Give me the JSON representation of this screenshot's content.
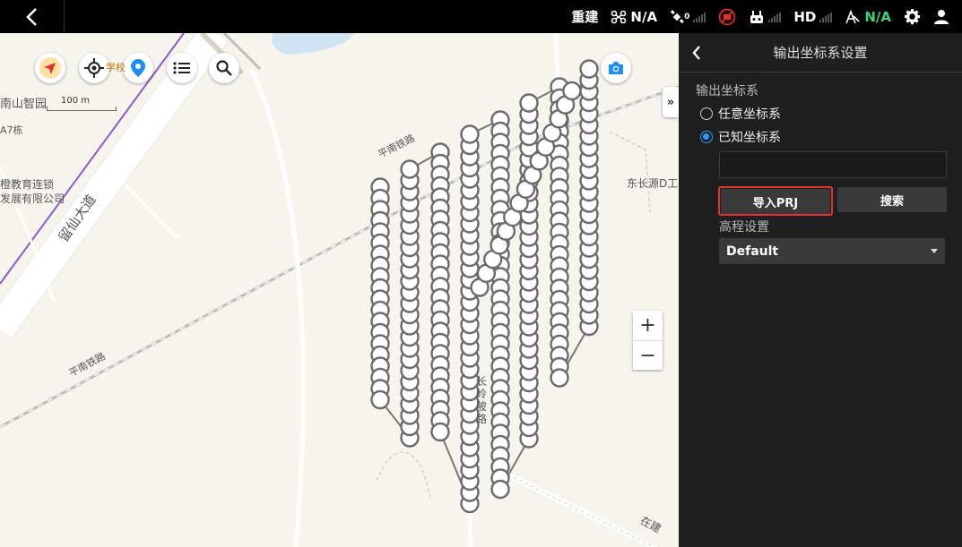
{
  "topbar": {
    "rebuild_label": "重建",
    "drone_status": "N/A",
    "gps_count": "0",
    "hd_label": "HD",
    "rtk_status": "N/A"
  },
  "map": {
    "scale_label": "100 m",
    "labels": {
      "poi_1": "南山智园",
      "poi_2": "A7栋",
      "poi_3": "橙教育连锁",
      "poi_4": "发展有限公司",
      "road_1": "留仙大道",
      "rail_1": "平南铁路",
      "rail_2": "平南铁路",
      "poi_5": "东长源D工",
      "road_2": "长岭陂路",
      "road_3": "在建",
      "poi_6": "学校"
    },
    "zoom_in": "+",
    "zoom_out": "−",
    "collapse": "»"
  },
  "panel": {
    "title": "输出坐标系设置",
    "output_coord_label": "输出坐标系",
    "option_arbitrary": "任意坐标系",
    "option_known": "已知坐标系",
    "coord_input_value": "",
    "import_prj_label": "导入PRJ",
    "search_label": "搜索",
    "elevation_label": "高程设置",
    "elevation_value": "Default"
  },
  "colors": {
    "accent": "#2e9bff",
    "highlight": "#e3342c",
    "panel_bg": "#1f1f1f",
    "green": "#3fd17a"
  }
}
